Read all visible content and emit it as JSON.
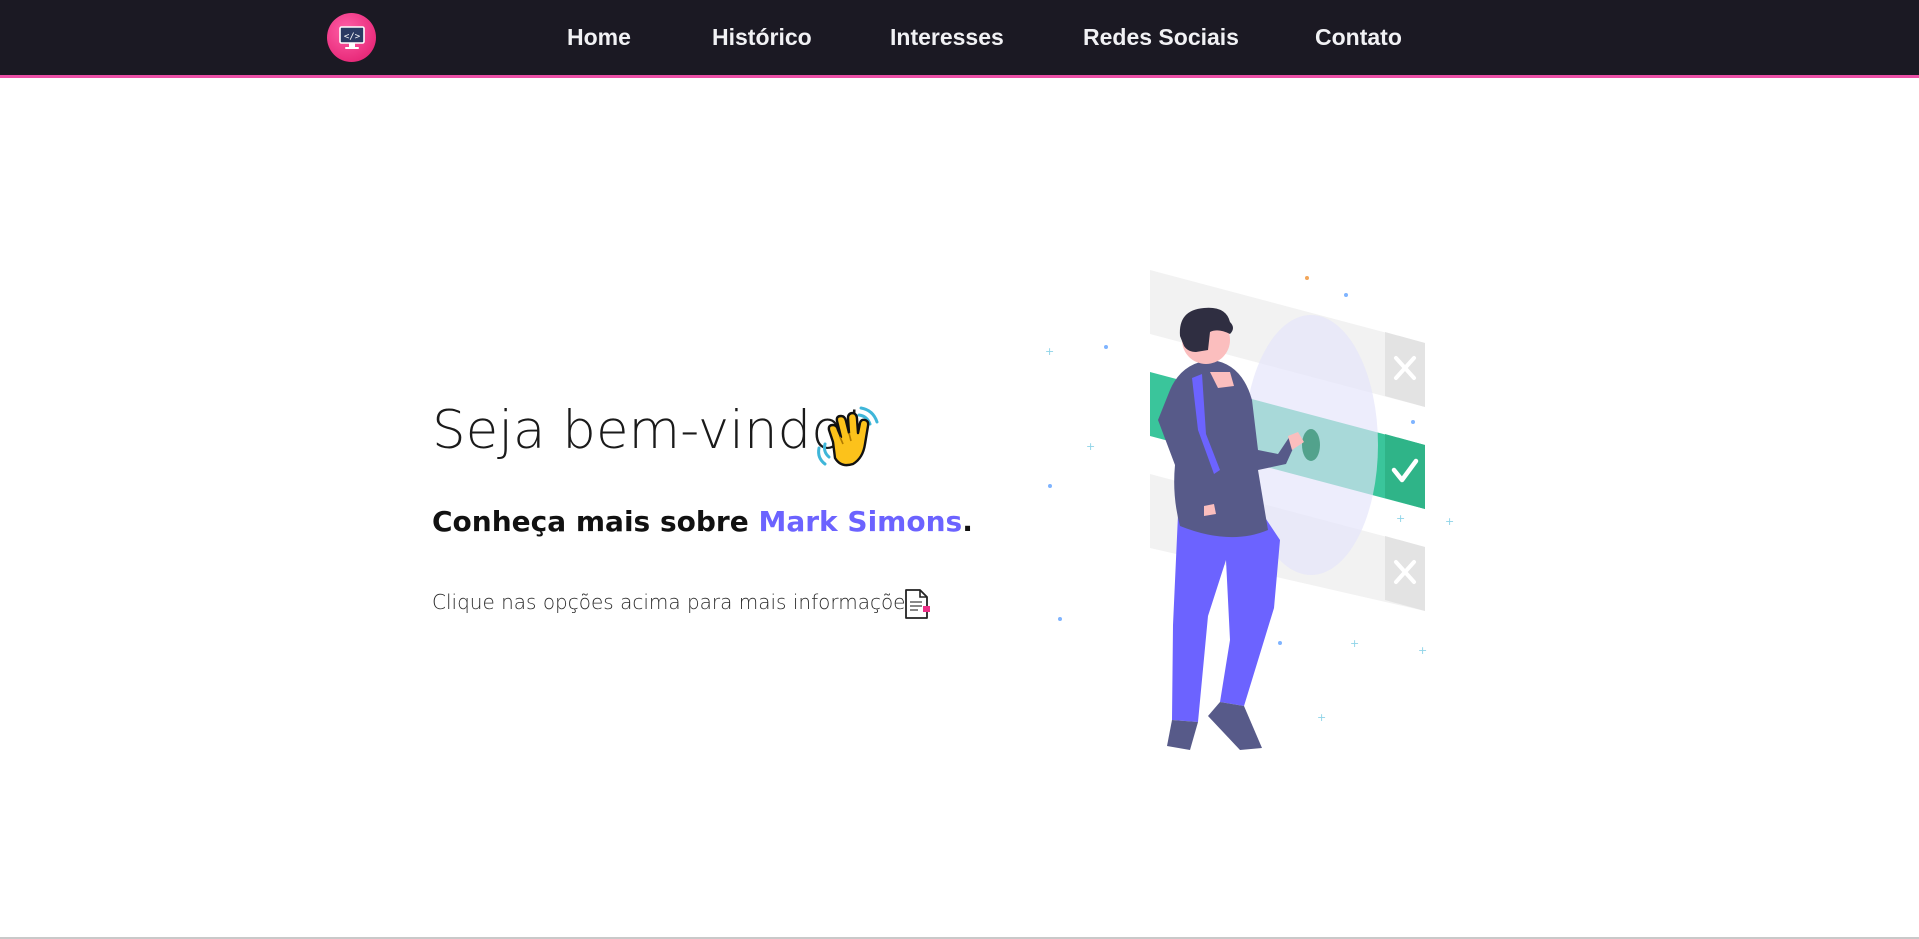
{
  "nav": {
    "logo_icon": "code-monitor-icon",
    "links": [
      {
        "label": "Home"
      },
      {
        "label": "Histórico"
      },
      {
        "label": "Interesses"
      },
      {
        "label": "Redes Sociais"
      },
      {
        "label": "Contato"
      }
    ]
  },
  "hero": {
    "title": "Seja bem-vindo!",
    "title_icon": "waving-hand-icon",
    "subtitle_prefix": "Conheça mais sobre ",
    "subtitle_name": "Mark Simons",
    "subtitle_suffix": ".",
    "hint": "Clique nas opções acima para mais informações",
    "hint_icon": "document-icon"
  },
  "colors": {
    "navbar_bg": "#1b1923",
    "nav_accent": "#ec4fa6",
    "name_accent": "#6c63ff",
    "check_green": "#3ac59b"
  }
}
